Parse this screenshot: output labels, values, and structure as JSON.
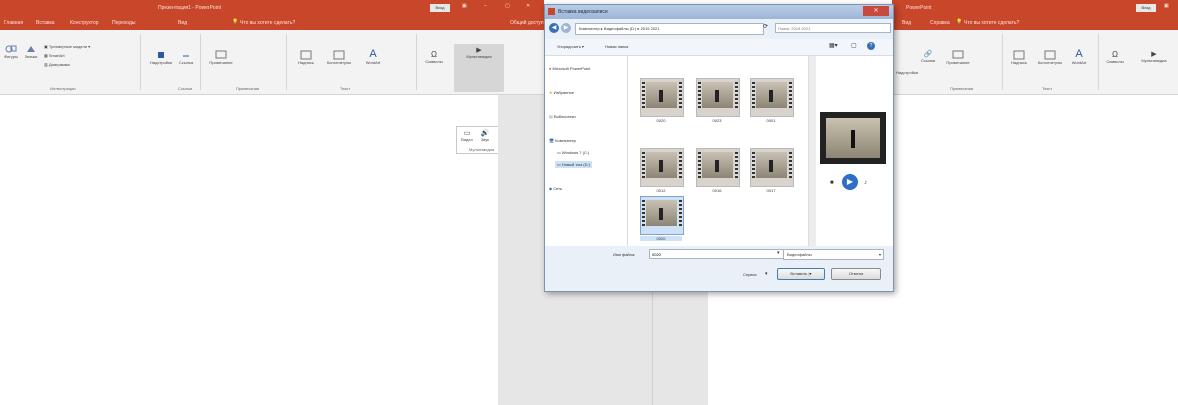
{
  "colors": {
    "accent": "#c8462a",
    "dialog_bg": "#eaf0f8"
  },
  "left_window": {
    "title": "Презентация1 - PowerPoint",
    "signin": "Вход",
    "tabs": [
      "Главная",
      "Вставка",
      "Конструктор",
      "Переходы",
      "Анимация",
      "Показ слайдов",
      "Рецензирование",
      "Вид"
    ],
    "tell_me": "Что вы хотите сделать?",
    "share": "Общий доступ",
    "ribbon": {
      "labels": [
        "Фигуры",
        "Значки",
        "Трехмерные модели",
        "SmartArt",
        "Диаграмма",
        "Надстройки",
        "Ссылка",
        "Действие",
        "Примечание",
        "Надпись",
        "Колонтитулы",
        "WordArt",
        "Символы",
        "Мультимедиа"
      ],
      "groups": [
        "Иллюстрации",
        "Ссылки",
        "Примечания",
        "Текст"
      ]
    },
    "media_menu": {
      "items": [
        "Видео",
        "Звук",
        "Запись экрана"
      ],
      "group": "Мультимедиа"
    }
  },
  "dialog": {
    "title": "Вставка видеозаписи",
    "breadcrumb": "Компьютер ▸ Видеофайлы (D:) ▸ 2019 2021",
    "search_placeholder": "Поиск: 2019 2021",
    "organize": "Упорядочить ▾",
    "new_folder": "Новая папка",
    "nav": [
      "Microsoft PowerPoint",
      "Избранное",
      "Библиотеки",
      "Компьютер",
      "Windows 7 (C:)",
      "Новый том (D:)",
      "Сеть"
    ],
    "files": [
      "0020",
      "0023",
      "0001",
      "0012",
      "0016",
      "0017",
      "0020"
    ],
    "filename_label": "Имя файла:",
    "filename_value": "0020",
    "filetype": "Видеофайлы",
    "tools": "Сервис",
    "insert": "Вставить",
    "cancel": "Отмена"
  },
  "right_window": {
    "title": "PowerPoint",
    "signin": "Вход",
    "tabs": [
      "Вид",
      "Справка"
    ],
    "tell_me": "Что вы хотите сделать?",
    "ribbon": {
      "labels": [
        "Надстройки",
        "Ссылки",
        "Примечание",
        "Надпись",
        "Колонтитулы",
        "WordArt",
        "Символы",
        "Мультимедиа"
      ],
      "groups": [
        "Примечания",
        "Текст"
      ]
    }
  }
}
